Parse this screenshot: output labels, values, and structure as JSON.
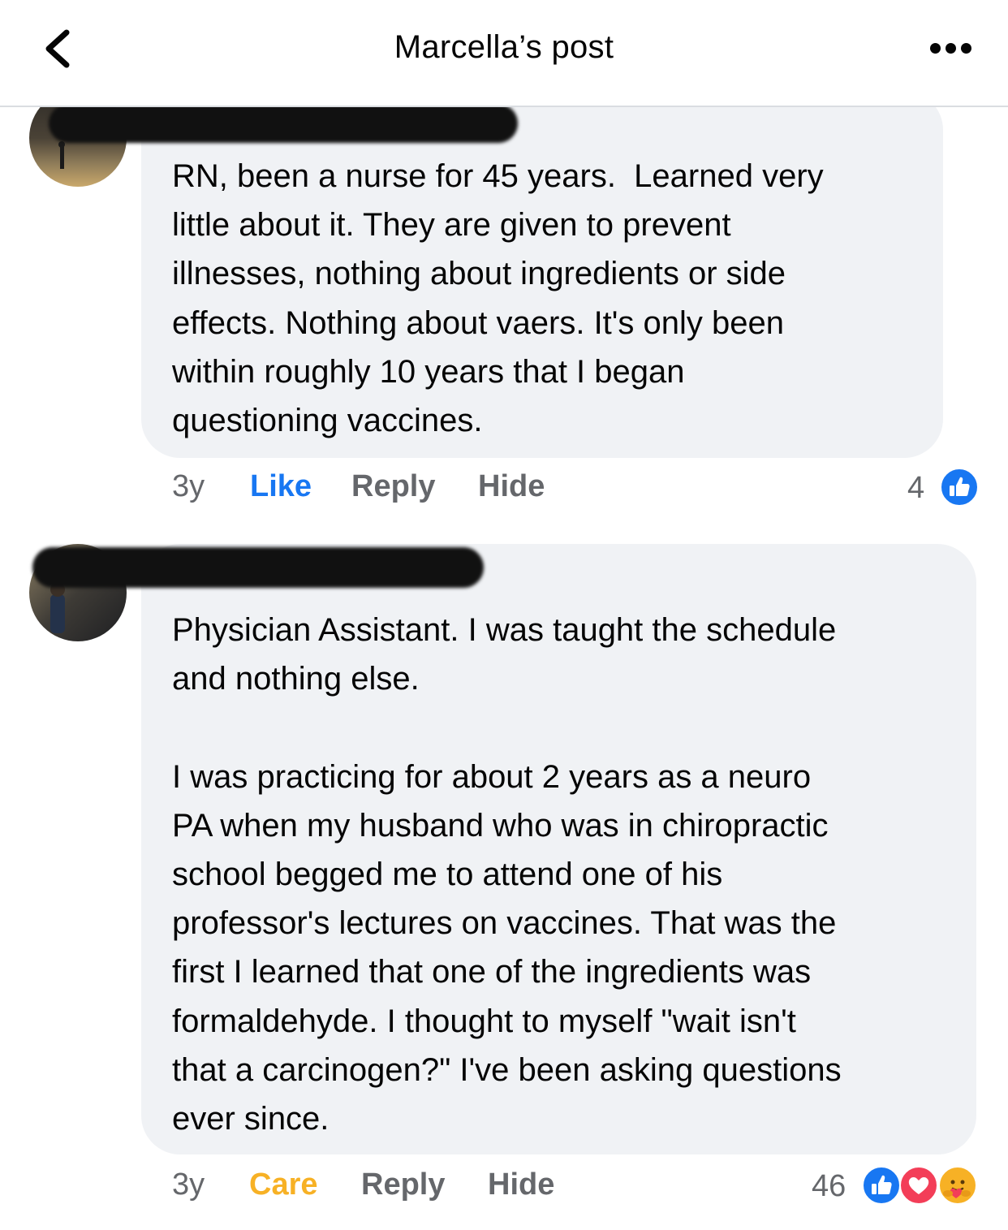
{
  "header": {
    "title": "Marcella’s post"
  },
  "comments": [
    {
      "text": "RN, been a nurse for 45 years.  Learned very\nlittle about it. They are given to prevent\nillnesses, nothing about ingredients or side\neffects. Nothing about vaers. It's only been\nwithin roughly 10 years that I began\nquestioning vaccines.",
      "time": "3y",
      "reaction_label": "Like",
      "reaction_color": "#1877f2",
      "reply_label": "Reply",
      "hide_label": "Hide",
      "reaction_count": "4",
      "reaction_icons": [
        "like-icon"
      ]
    },
    {
      "text": "Physician Assistant. I was taught the schedule\nand nothing else.\n\nI was practicing for about 2 years as a neuro\nPA when my husband who was in chiropractic\nschool begged me to attend one of his\nprofessor's lectures on vaccines. That was the\nfirst I learned that one of the ingredients was\nformaldehyde. I thought to myself \"wait isn't\nthat a carcinogen?\" I've been asking questions\never since.",
      "time": "3y",
      "reaction_label": "Care",
      "reaction_color": "#f7b125",
      "reply_label": "Reply",
      "hide_label": "Hide",
      "reaction_count": "46",
      "reaction_icons": [
        "like-icon",
        "love-icon",
        "care-icon"
      ]
    }
  ]
}
